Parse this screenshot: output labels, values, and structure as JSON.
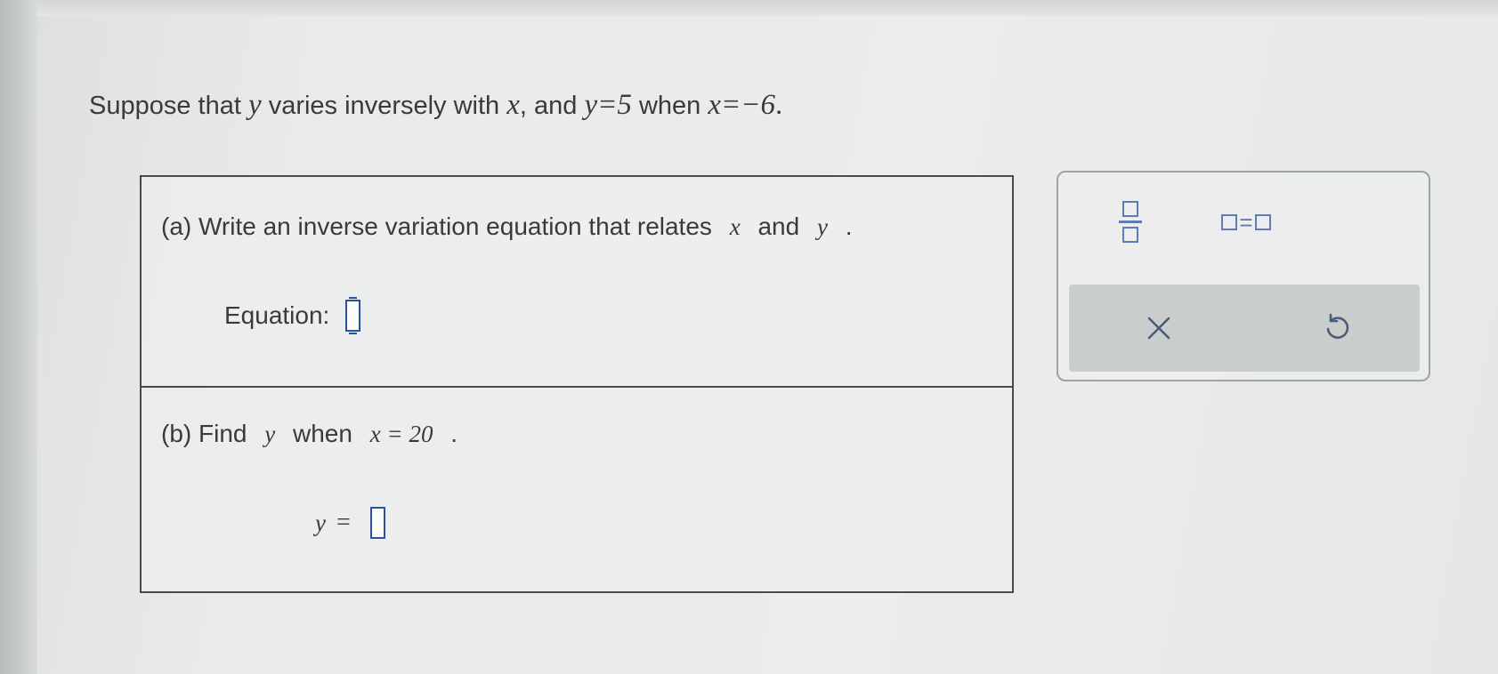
{
  "problem": {
    "intro_text": "Suppose that",
    "var_y": "y",
    "varies_text": "varies inversely with",
    "var_x": "x",
    "and_text": ", and",
    "condition_1": "y=5",
    "when_text": "when",
    "condition_2": "x=−6",
    "period": "."
  },
  "part_a": {
    "label": "(a) Write an inverse variation equation that relates",
    "var_x": "x",
    "and_text": "and",
    "var_y": "y",
    "period": ".",
    "answer_label": "Equation:",
    "answer_value": ""
  },
  "part_b": {
    "label": "(b) Find",
    "var_y": "y",
    "when_text": "when",
    "condition": "x = 20",
    "period": ".",
    "answer_var": "y",
    "answer_eq": "=",
    "answer_value": ""
  },
  "tool_panel": {
    "fraction_tool": "fraction",
    "equals_tool_sign": "=",
    "clear_symbol": "×",
    "undo_symbol": "↺"
  },
  "colors": {
    "input_border": "#2e4fa0",
    "tool_icon": "#5e7bb5",
    "action_bar": "#c9cecd"
  }
}
